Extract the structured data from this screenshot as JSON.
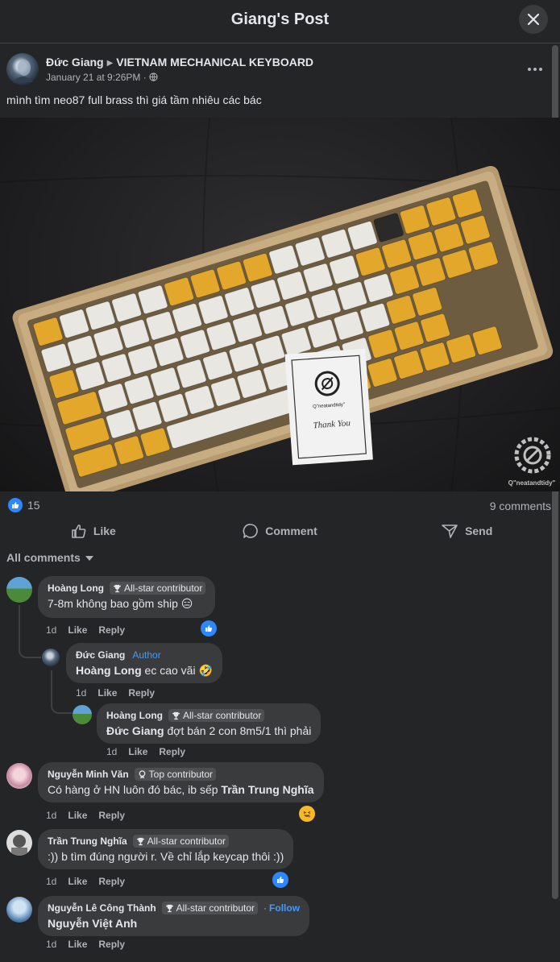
{
  "header": {
    "title": "Giang's Post"
  },
  "post": {
    "author": "Đức Giang",
    "group": "VIETNAM MECHANICAL KEYBOARD",
    "date": "January 21 at 9:26PM",
    "separator": "·",
    "privacy_icon": "globe-icon",
    "text": "mình tìm neo87 full brass thì giá tầm nhiêu các bác",
    "image_card": {
      "brand": "Q\"neatandtidy\"",
      "signature": "Thank You"
    },
    "watermark": "Q\"neatandtidy\"",
    "reaction_count": "15",
    "comments_count": "9 comments"
  },
  "actions": {
    "like": "Like",
    "comment": "Comment",
    "send": "Send"
  },
  "comments_filter": "All comments",
  "comment_labels": {
    "like": "Like",
    "reply": "Reply"
  },
  "comments": [
    {
      "name": "Hoàng Long",
      "badge": "All-star contributor",
      "text": "7-8m không bao gồm ship 😑",
      "time": "1d",
      "reaction": "like"
    },
    {
      "name": "Đức Giang",
      "badge": "Author",
      "mention": "Hoàng Long",
      "text": " ec cao vãi 🤣",
      "time": "1d"
    },
    {
      "name": "Hoàng Long",
      "badge": "All-star contributor",
      "mention": "Đức Giang",
      "text": " đợt bán 2 con 8m5/1 thì phải",
      "time": "1d"
    },
    {
      "name": "Nguyễn Minh Văn",
      "badge": "Top contributor",
      "text": "Có hàng ở HN luôn đó bác, ib sếp ",
      "mention_end": "Trần Trung Nghĩa",
      "time": "1d",
      "reaction": "haha"
    },
    {
      "name": "Trần Trung Nghĩa",
      "badge": "All-star contributor",
      "text": ":)) b tìm đúng người r. Về chỉ lắp keycap thôi :))",
      "time": "1d",
      "reaction": "like"
    },
    {
      "name": "Nguyễn Lê Công Thành",
      "badge": "All-star contributor",
      "follow": "Follow",
      "follow_sep": "·",
      "mention": "Nguyễn Việt Anh",
      "text": "",
      "time": "1d"
    }
  ]
}
